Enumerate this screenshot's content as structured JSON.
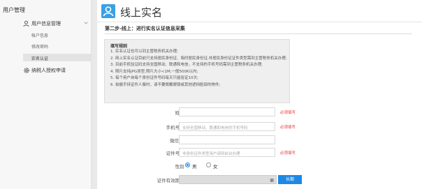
{
  "sidebar": {
    "title": "用户管理",
    "group_label": "用户信息管理",
    "sub_items": [
      {
        "label": "帐户信息"
      },
      {
        "label": "修改密码"
      },
      {
        "label": "实名认证"
      }
    ],
    "other_label": "纳税人授权申请"
  },
  "header": {
    "title": "线上实名"
  },
  "step_title": "第二步-线上：进行实名认证信息采集",
  "notice": {
    "title": "填写规则",
    "items": [
      "1. 实名认证也可以到主管税务机关办理;",
      "2. 网上实名认证目前只支持居民身份证、临时居民身份证,非居民身份证证件类型需到主管税务机关办理;",
      "3. 目前手机验证码支持全国移动、联通和电信，不支持的手机号码需到主管税务机关办理;",
      "4. 照片支持JPG类型,照片大小<1M,一般500K以内;",
      "5. 每个用户自每个身份证件号码每天只能验证10次;",
      "6. 拍摄手持证件人像时，请不要佩戴眼镜或其他遮挡脸部的物件;"
    ]
  },
  "form": {
    "name_label": "姓名",
    "required_text": "必须填写",
    "phone_label": "手机号码",
    "phone_placeholder": "支持全国移动、联通和电信的手机号码",
    "wechat_label": "微信号码",
    "id_label": "证件号码",
    "id_placeholder": "非身份证件类型用户请到前台办理",
    "gender_label": "性别",
    "gender_male": "男",
    "gender_female": "女",
    "validity_label": "证件有效期止",
    "long_term_button": "长期"
  }
}
